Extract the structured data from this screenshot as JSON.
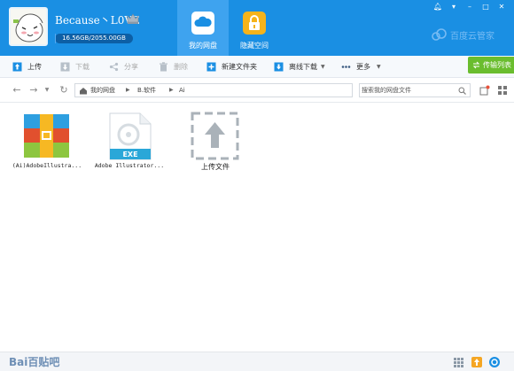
{
  "header": {
    "username": "Because丶L0VE",
    "quota": "16.56GB/2055.00GB",
    "quota_fraction": 0.008,
    "tabs": [
      {
        "label": "我的网盘",
        "icon": "cloud-icon",
        "active": true
      },
      {
        "label": "隐藏空间",
        "icon": "lock-icon",
        "active": false
      }
    ],
    "brand": "百度云管家",
    "window_buttons": [
      "bell-icon",
      "menu-icon",
      "minimize-icon",
      "maximize-icon",
      "close-icon"
    ]
  },
  "toolbar": {
    "upload": "上传",
    "download": "下载",
    "share": "分享",
    "delete": "删除",
    "new_folder": "新建文件夹",
    "offline_download": "离线下载",
    "more": "更多",
    "transfer_list": "传输列表"
  },
  "addressbar": {
    "crumbs": [
      "我的网盘",
      "B.软件",
      "Ai"
    ],
    "search_placeholder": "搜索我的网盘文件"
  },
  "files": [
    {
      "name": "(Ai)AdobeIllustra...",
      "icon": "archive-icon"
    },
    {
      "name": "Adobe Illustrator...",
      "icon": "exe-file-icon",
      "badge": "EXE"
    },
    {
      "name": "上传文件",
      "icon": "upload-placeholder-icon"
    }
  ],
  "footer": {
    "watermark": "Bai百贴吧"
  },
  "colors": {
    "header_blue": "#1a8fe3",
    "active_tab": "#3ea3ef",
    "transfer_green": "#6abd2e"
  }
}
